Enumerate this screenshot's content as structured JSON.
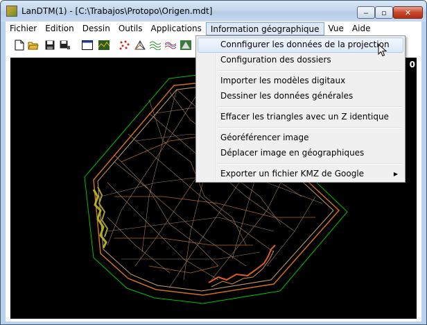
{
  "window": {
    "title": "LanDTM(1) - [C:\\Trabajos\\Protopo\\Origen.mdt]",
    "minimize_glyph": "‒",
    "maximize_glyph": "▫",
    "close_glyph": "✕"
  },
  "menubar": {
    "items": [
      {
        "label": "Fichier"
      },
      {
        "label": "Edition"
      },
      {
        "label": "Dessin"
      },
      {
        "label": "Outils"
      },
      {
        "label": "Applications"
      },
      {
        "label": "Information géographique",
        "active": true
      },
      {
        "label": "Vue"
      },
      {
        "label": "Aide"
      }
    ]
  },
  "toolbar": {
    "icons": [
      "new-file-icon",
      "open-folder-icon",
      "save-icon",
      "save-all-icon",
      "window-icon",
      "terrain-icon",
      "points-icon",
      "triangulate-icon",
      "contours-icon",
      "profile-icon",
      "map-icon"
    ]
  },
  "dropdown": {
    "items": [
      {
        "label": "Connfigurer les données de la projection",
        "highlighted": true
      },
      {
        "label": "Configuration des dossiers"
      },
      {
        "label": "Importer les modèles digitaux"
      },
      {
        "label": "Dessiner les données générales"
      },
      {
        "label": "Effacer les triangles avec un Z identique"
      },
      {
        "label": "Géoréférencer image"
      },
      {
        "label": "Déplacer image en géographiques"
      },
      {
        "label": "Exporter un fichier KMZ de Google",
        "submenu": true
      }
    ],
    "submenu_arrow": "▶"
  },
  "canvas": {
    "corner_text": "0",
    "colors": {
      "background": "#000000",
      "boundary": "#00c000",
      "mesh": "#c8a070",
      "contours": "#d07020",
      "edge": "#b0b020"
    }
  }
}
